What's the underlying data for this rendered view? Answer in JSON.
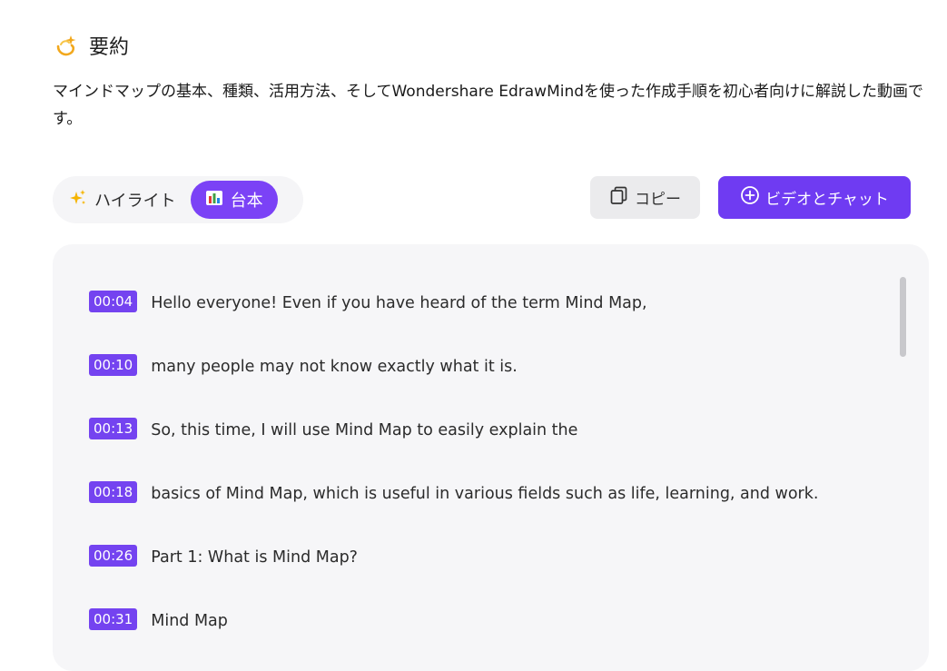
{
  "summary": {
    "title": "要約",
    "icon": "sparkle-comet-icon",
    "text": "マインドマップの基本、種類、活用方法、そしてWondershare EdrawMindを使った作成手順を初心者向けに解説した動画です。"
  },
  "tabs": [
    {
      "label": "ハイライト",
      "icon": "sparkles-icon",
      "active": false
    },
    {
      "label": "台本",
      "icon": "bar-chart-icon",
      "active": true
    }
  ],
  "actions": {
    "copy_label": "コピー",
    "chat_label": "ビデオとチャット"
  },
  "transcript": [
    {
      "time": "00:04",
      "text": "Hello everyone! Even if you have heard of the term Mind Map,"
    },
    {
      "time": "00:10",
      "text": "many people may not know exactly what it is."
    },
    {
      "time": "00:13",
      "text": "So, this time, I will use Mind Map to easily explain the"
    },
    {
      "time": "00:18",
      "text": "basics of Mind Map, which is useful in various fields such as life, learning, and work."
    },
    {
      "time": "00:26",
      "text": "Part 1: What is Mind Map?"
    },
    {
      "time": "00:31",
      "text": "Mind Map"
    }
  ],
  "colors": {
    "accent": "#7B42F6",
    "button_primary": "#6F3BF2",
    "timestamp": "#7443F0",
    "panel_bg": "#F6F6F8"
  }
}
